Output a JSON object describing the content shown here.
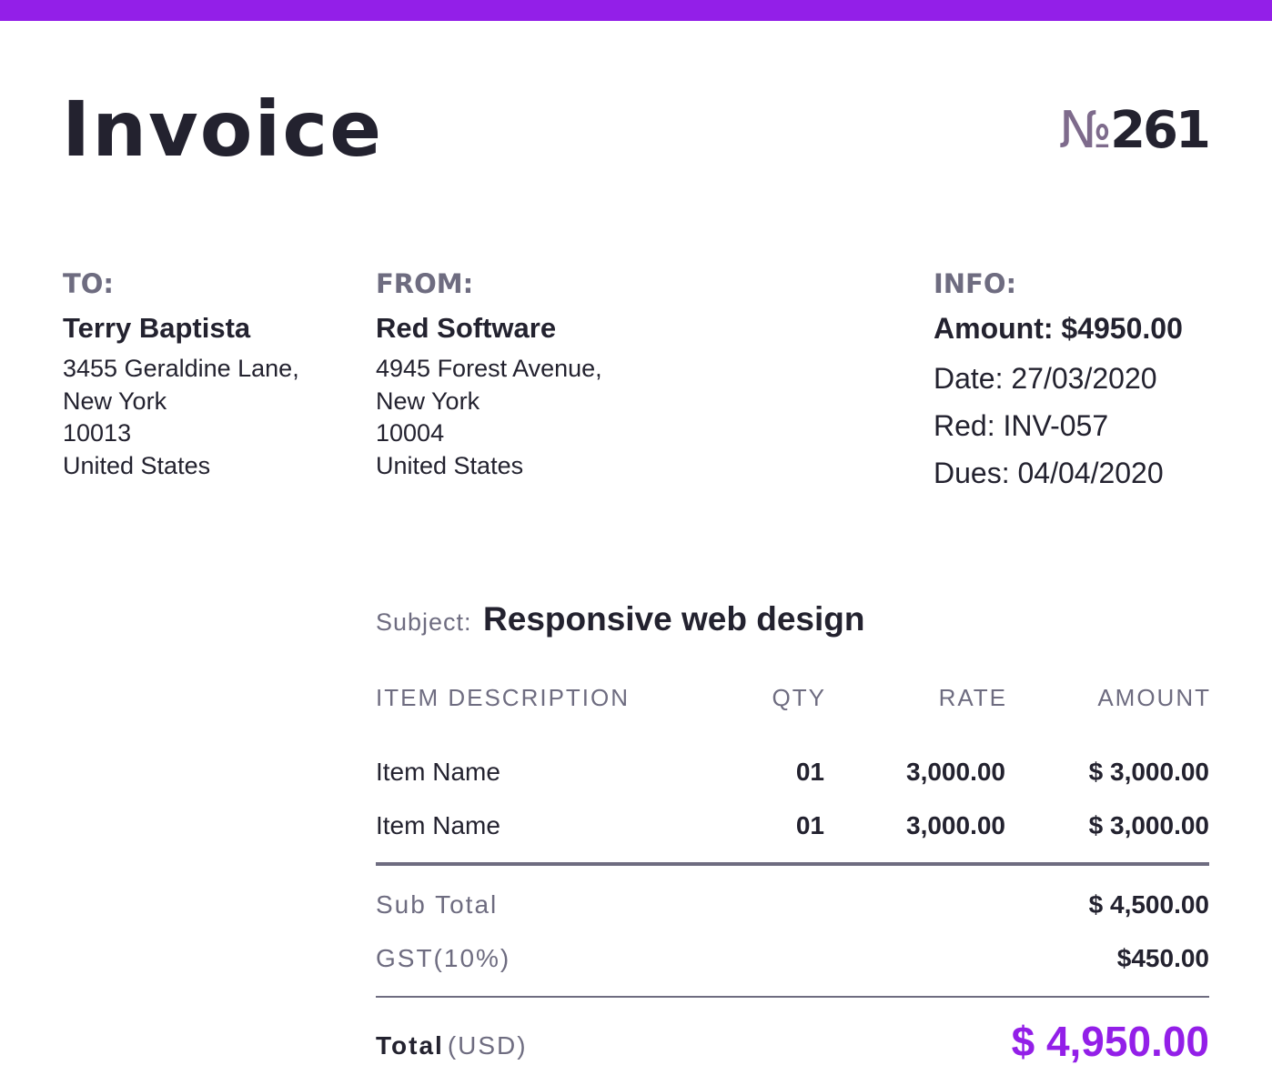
{
  "colors": {
    "accent": "#931fe8",
    "text": "#23222f",
    "muted": "#6e6c80",
    "number_symbol": "#7e6b8c"
  },
  "header": {
    "title": "Invoice",
    "number_symbol": "№",
    "number": "261"
  },
  "to": {
    "label": "TO:",
    "name": "Terry Baptista",
    "address": [
      "3455  Geraldine Lane,",
      "New York",
      "10013",
      "United States"
    ]
  },
  "from": {
    "label": "FROM:",
    "name": "Red Software",
    "address": [
      "4945  Forest Avenue,",
      "New York",
      "10004",
      "United States"
    ]
  },
  "info": {
    "label": "INFO:",
    "amount": "Amount: $4950.00",
    "date": "Date: 27/03/2020",
    "ref": "Red: INV-057",
    "due": "Dues: 04/04/2020"
  },
  "subject": {
    "label": "Subject:",
    "value": "Responsive web design"
  },
  "table": {
    "columns": [
      "ITEM DESCRIPTION",
      "QTY",
      "RATE",
      "AMOUNT"
    ],
    "rows": [
      {
        "description": "Item Name",
        "qty": "01",
        "rate": "3,000.00",
        "amount": "$ 3,000.00"
      },
      {
        "description": "Item Name",
        "qty": "01",
        "rate": "3,000.00",
        "amount": "$ 3,000.00"
      }
    ]
  },
  "summary": {
    "subtotal_label": "Sub Total",
    "subtotal_value": "$ 4,500.00",
    "gst_label": "GST(10%)",
    "gst_value": "$450.00",
    "total_label": "Total",
    "total_unit": "(USD)",
    "total_value": "$ 4,950.00"
  }
}
